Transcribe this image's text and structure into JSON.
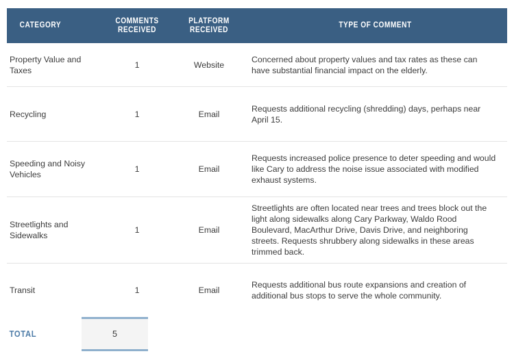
{
  "table": {
    "columns": [
      {
        "id": "category",
        "label": "CATEGORY"
      },
      {
        "id": "comments_received",
        "label_line1": "COMMENTS",
        "label_line2": "RECEIVED"
      },
      {
        "id": "platform_received",
        "label_line1": "PLATFORM",
        "label_line2": "RECEIVED"
      },
      {
        "id": "type_of_comment",
        "label": "TYPE OF COMMENT"
      }
    ],
    "rows": [
      {
        "category": "Property Value and Taxes",
        "comments_received": "1",
        "platform_received": "Website",
        "type_of_comment": "Concerned about property values and tax rates as these can have substantial financial impact on the elderly."
      },
      {
        "category": "Recycling",
        "comments_received": "1",
        "platform_received": "Email",
        "type_of_comment": "Requests additional recycling (shredding) days, perhaps near April 15."
      },
      {
        "category": "Speeding and Noisy Vehicles",
        "comments_received": "1",
        "platform_received": "Email",
        "type_of_comment": "Requests increased police presence to deter speeding and would like Cary to address the noise issue associated with modified exhaust systems."
      },
      {
        "category": "Streetlights and Sidewalks",
        "comments_received": "1",
        "platform_received": "Email",
        "type_of_comment": "Streetlights are often located near trees and trees block out the light along sidewalks along Cary Parkway, Waldo Rood Boulevard, MacArthur Drive, Davis Drive, and neighboring streets. Requests shrubbery along sidewalks in these areas trimmed back."
      },
      {
        "category": "Transit",
        "comments_received": "1",
        "platform_received": "Email",
        "type_of_comment": "Requests additional bus route expansions and creation of additional bus stops to serve the whole community."
      }
    ],
    "total": {
      "label": "TOTAL",
      "value": "5"
    },
    "colors": {
      "header_background": "#3a5f83",
      "header_text": "#ffffff",
      "body_text": "#3b3b3b",
      "row_divider": "#e3e3e3",
      "total_label": "#4f7da8",
      "total_box_background": "#f4f4f4",
      "total_box_border": "#8fb0cd"
    }
  }
}
